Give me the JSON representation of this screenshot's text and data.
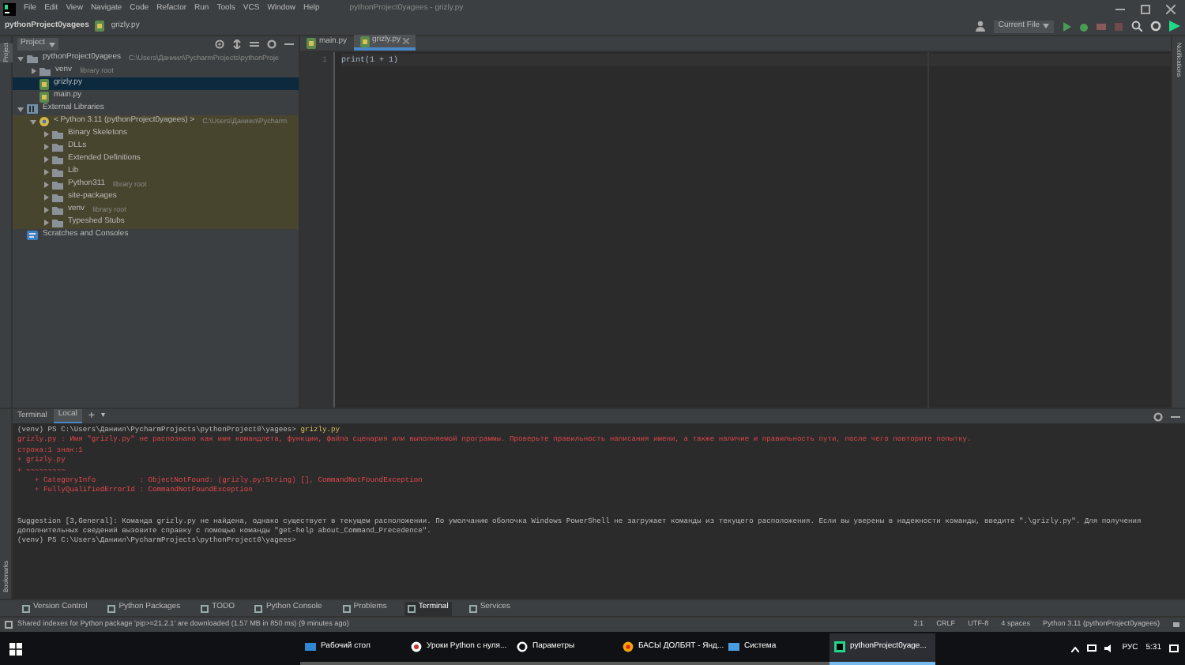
{
  "menu_bar": {
    "items": [
      "File",
      "Edit",
      "View",
      "Navigate",
      "Code",
      "Refactor",
      "Run",
      "Tools",
      "VCS",
      "Window",
      "Help"
    ],
    "title": "pythonProject0yagees - grizly.py"
  },
  "nav_bar": {
    "breadcrumbs": [
      "pythonProject0yagees",
      "grizly.py"
    ],
    "run_config": "Current File"
  },
  "left_strip": {
    "label": "Project"
  },
  "project_panel": {
    "title": "Project",
    "tree": [
      {
        "name": "pythonProject0yagees",
        "note": "C:\\Users\\Даниил\\PycharmProjects\\pythonProje",
        "kind": "folder",
        "expanded": true,
        "selected": false,
        "children": [
          {
            "name": "venv",
            "note": "library root",
            "kind": "folder",
            "expanded": false,
            "selected": false
          },
          {
            "name": "grizly.py",
            "kind": "python",
            "selected": true
          },
          {
            "name": "main.py",
            "kind": "python",
            "selected": false
          }
        ]
      },
      {
        "name": "External Libraries",
        "kind": "libraries",
        "expanded": true,
        "selected": false,
        "children": [
          {
            "name": "< Python 3.11 (pythonProject0yagees) >",
            "note": "C:\\Users\\Даниил\\Pycharm",
            "kind": "sdk",
            "expanded": true,
            "selected": false,
            "children": [
              {
                "name": "Binary Skeletons",
                "kind": "folder",
                "expanded": false,
                "selected": false
              },
              {
                "name": "DLLs",
                "kind": "folder",
                "expanded": false,
                "selected": false
              },
              {
                "name": "Extended Definitions",
                "kind": "folder",
                "expanded": false,
                "selected": false
              },
              {
                "name": "Lib",
                "kind": "folder",
                "expanded": false,
                "selected": false
              },
              {
                "name": "Python311",
                "note": "library root",
                "kind": "folder",
                "expanded": false,
                "selected": false
              },
              {
                "name": "site-packages",
                "kind": "folder",
                "expanded": false,
                "selected": false
              },
              {
                "name": "venv",
                "note": "library root",
                "kind": "folder",
                "expanded": false,
                "selected": false
              },
              {
                "name": "Typeshed Stubs",
                "kind": "folder",
                "expanded": false,
                "selected": false
              }
            ]
          }
        ]
      },
      {
        "name": "Scratches and Consoles",
        "kind": "scratches",
        "selected": false
      }
    ]
  },
  "editor": {
    "tabs": [
      {
        "label": "main.py",
        "selected": false
      },
      {
        "label": "grizly.py",
        "selected": true
      }
    ],
    "lines": [
      {
        "number": "1",
        "code": "print(1 + 1)"
      }
    ]
  },
  "right_strip": {
    "label": "Notifications"
  },
  "bottom_strip": {
    "label": "Bookmarks"
  },
  "terminal": {
    "title": "Terminal",
    "tabs": [
      {
        "label": "Local",
        "selected": true
      }
    ],
    "add": "+",
    "more": "▾",
    "lines": [
      {
        "kind": "prompt",
        "text": "(venv) PS C:\\Users\\Даниил\\PycharmProjects\\pythonProject0\\yagees> ",
        "command": "grizly.py"
      },
      {
        "kind": "error",
        "text": "grizly.py : Имя \"grizly.py\" не распознано как имя командлета, функции, файла сценария или выполняемой программы. Проверьте правильность написания имени, а также наличие и правильность пути, после чего повторите попытку."
      },
      {
        "kind": "error",
        "text": "строка:1 знак:1"
      },
      {
        "kind": "error",
        "text": "+ grizly.py"
      },
      {
        "kind": "error",
        "text": "+ ~~~~~~~~~"
      },
      {
        "kind": "error",
        "text": "    + CategoryInfo          : ObjectNotFound: (grizly.py:String) [], CommandNotFoundException"
      },
      {
        "kind": "error",
        "text": "    + FullyQualifiedErrorId : CommandNotFoundException"
      },
      {
        "kind": "blank"
      },
      {
        "kind": "blank"
      },
      {
        "kind": "output",
        "text": "Suggestion [3,General]: Команда grizly.py не найдена, однако существует в текущем расположении. По умолчанию оболочка Windows PowerShell не загружает команды из текущего расположения. Если вы уверены в надежности команды, введите \".\\grizly.py\". Для получения дополнительных сведений вызовите справку с помощью команды \"get-help about_Command_Precedence\"."
      },
      {
        "kind": "prompt",
        "text": "(venv) PS C:\\Users\\Даниил\\PycharmProjects\\pythonProject0\\yagees>"
      }
    ]
  },
  "tool_windows": [
    {
      "label": "Version Control",
      "selected": false
    },
    {
      "label": "Python Packages",
      "selected": false
    },
    {
      "label": "TODO",
      "selected": false
    },
    {
      "label": "Python Console",
      "selected": false
    },
    {
      "label": "Problems",
      "selected": false
    },
    {
      "label": "Terminal",
      "selected": true
    },
    {
      "label": "Services",
      "selected": false
    }
  ],
  "status_bar": {
    "message": "Shared indexes for Python package 'pip>=21.2.1' are downloaded (1.57 MB in 850 ms) (9 minutes ago)",
    "items": [
      "2:1",
      "CRLF",
      "UTF-8",
      "4 spaces",
      "Python 3.11 (pythonProject0yagees)"
    ]
  },
  "taskbar": {
    "apps": [
      {
        "label": "Рабочий стол",
        "kind": "folder",
        "selected": false
      },
      {
        "label": "Уроки Python с нуля...",
        "kind": "browser",
        "selected": false
      },
      {
        "label": "Параметры",
        "kind": "settings",
        "selected": false
      },
      {
        "label": "БАСЫ ДОЛБЯТ - Янд...",
        "kind": "yandex",
        "selected": false
      },
      {
        "label": "Система",
        "kind": "system",
        "selected": false
      },
      {
        "label": "pythonProject0yage...",
        "kind": "pycharm",
        "selected": true
      }
    ],
    "language": "РУС",
    "clock": "5:31"
  }
}
